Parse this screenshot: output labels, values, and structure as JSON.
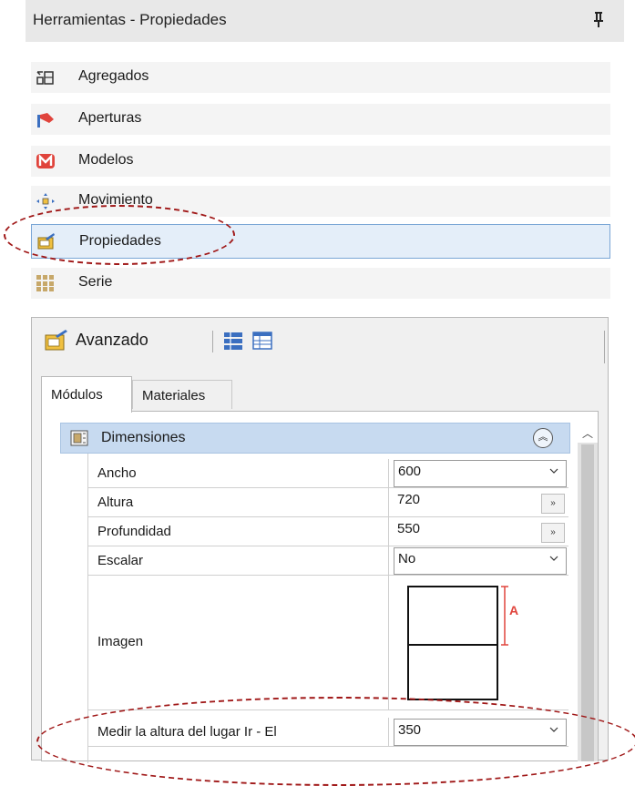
{
  "window": {
    "title": "Herramientas - Propiedades"
  },
  "tools": [
    {
      "label": "Agregados",
      "icon": "aggregate-icon"
    },
    {
      "label": "Aperturas",
      "icon": "openings-icon"
    },
    {
      "label": "Modelos",
      "icon": "models-icon"
    },
    {
      "label": "Movimiento",
      "icon": "move-icon"
    },
    {
      "label": "Propiedades",
      "icon": "properties-icon",
      "selected": true
    },
    {
      "label": "Serie",
      "icon": "series-icon"
    }
  ],
  "panel": {
    "toolbar_label": "Avanzado",
    "tabs": [
      {
        "label": "Módulos",
        "active": true
      },
      {
        "label": "Materiales",
        "active": false
      }
    ],
    "group": {
      "label": "Dimensiones"
    },
    "rows": [
      {
        "label": "Ancho",
        "value": "600",
        "control": "dropdown"
      },
      {
        "label": "Altura",
        "value": "720",
        "control": "button",
        "button_label": "»"
      },
      {
        "label": "Profundidad",
        "value": "550",
        "control": "button",
        "button_label": "»"
      },
      {
        "label": "Escalar",
        "value": "No",
        "control": "dropdown"
      },
      {
        "label": "Imagen",
        "value": "",
        "control": "image",
        "marker": "A"
      },
      {
        "label": "Medir la altura del lugar Ir - El",
        "value": "350",
        "control": "dropdown"
      }
    ]
  },
  "colors": {
    "accent": "#7aa6d6",
    "group_header": "#c7daf0",
    "annotation": "#a01818"
  }
}
